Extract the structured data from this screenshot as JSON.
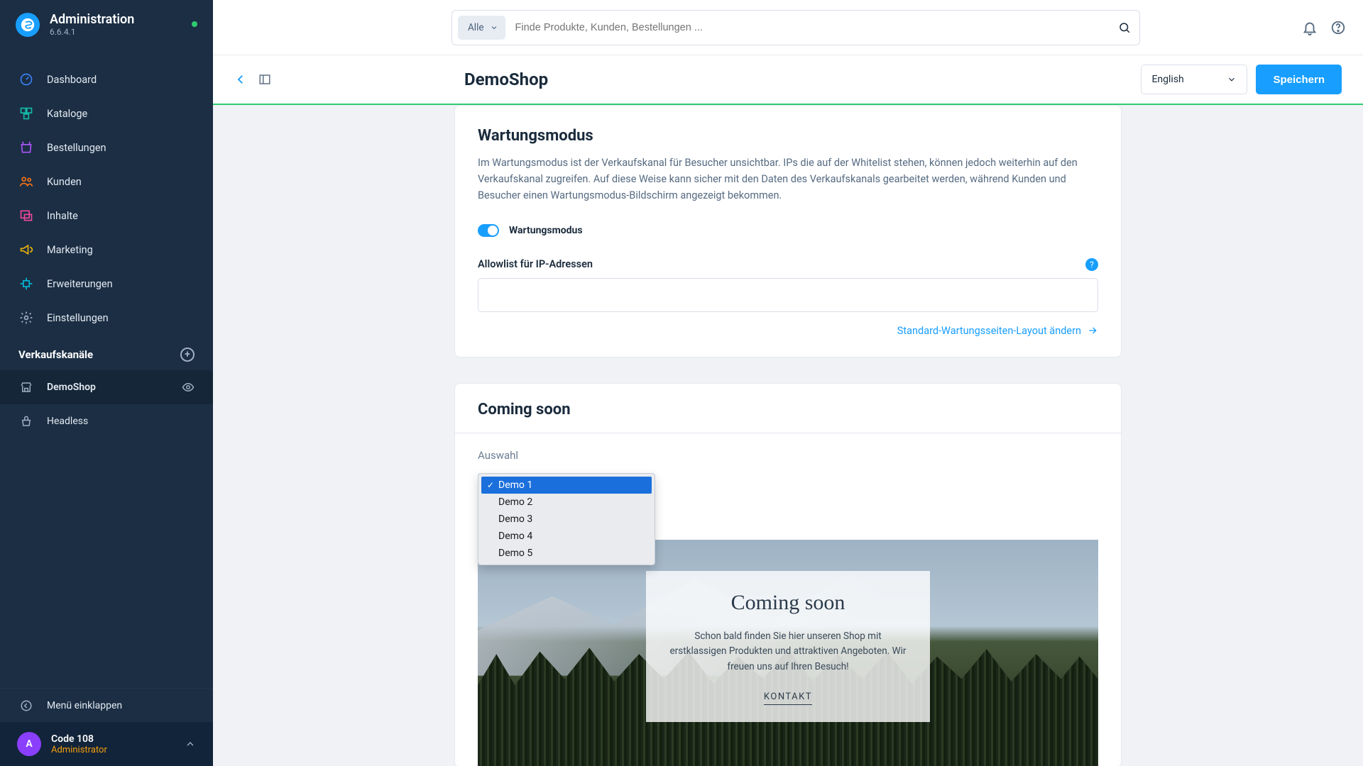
{
  "brand": {
    "title": "Administration",
    "version": "6.6.4.1"
  },
  "nav": [
    {
      "label": "Dashboard"
    },
    {
      "label": "Kataloge"
    },
    {
      "label": "Bestellungen"
    },
    {
      "label": "Kunden"
    },
    {
      "label": "Inhalte"
    },
    {
      "label": "Marketing"
    },
    {
      "label": "Erweiterungen"
    },
    {
      "label": "Einstellungen"
    }
  ],
  "sales_channels": {
    "title": "Verkaufskanäle",
    "items": [
      {
        "name": "DemoShop",
        "active": true
      },
      {
        "name": "Headless",
        "active": false
      }
    ]
  },
  "collapse_label": "Menü einklappen",
  "user": {
    "initial": "A",
    "name": "Code 108",
    "role": "Administrator"
  },
  "search": {
    "type_label": "Alle",
    "placeholder": "Finde Produkte, Kunden, Bestellungen ..."
  },
  "page": {
    "title": "DemoShop",
    "language": "English",
    "save": "Speichern"
  },
  "maintenance": {
    "title": "Wartungsmodus",
    "description": "Im Wartungsmodus ist der Verkaufskanal für Besucher unsichtbar. IPs die auf der Whitelist stehen, können jedoch weiterhin auf den Verkaufskanal zugreifen. Auf diese Weise kann sicher mit den Daten des Verkaufskanals gearbeitet werden, während Kunden und Besucher einen Wartungsmodus-Bildschirm angezeigt bekommen.",
    "toggle_label": "Wartungsmodus",
    "allowlist_label": "Allowlist für IP-Adressen",
    "layout_link": "Standard-Wartungsseiten-Layout ändern"
  },
  "coming_soon": {
    "title": "Coming soon",
    "select_label": "Auswahl",
    "options": [
      "Demo 1",
      "Demo 2",
      "Demo 3",
      "Demo 4",
      "Demo 5"
    ],
    "preview": {
      "heading": "Coming soon",
      "text": "Schon bald finden Sie hier unseren Shop mit erstklassigen Produkten und attraktiven Angeboten. Wir freuen uns auf Ihren Besuch!",
      "cta": "KONTAKT"
    }
  }
}
